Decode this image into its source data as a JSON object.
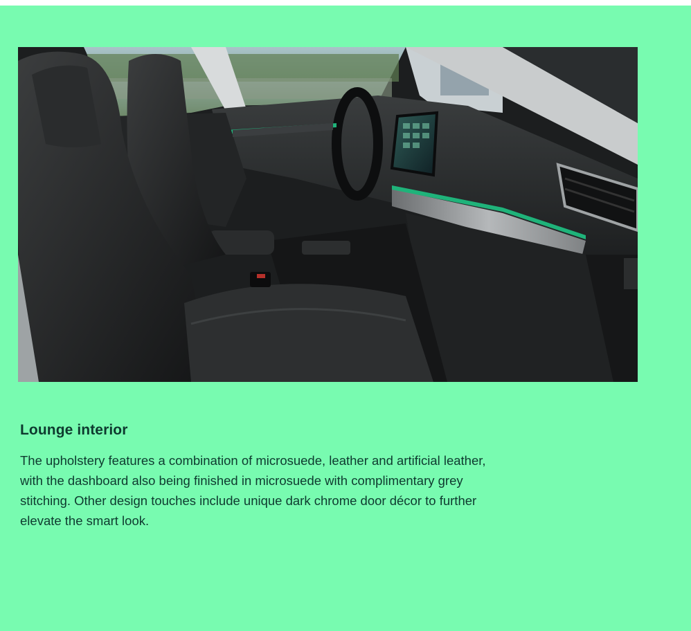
{
  "section": {
    "title": "Lounge interior",
    "body": "The upholstery features a combination of microsuede, leather and artificial leather, with the dashboard also being finished in microsuede with complimentary grey stitching. Other design touches include unique dark chrome door décor to further elevate the smart look."
  },
  "image": {
    "alt": "Car interior with black microsuede seats, dashboard with touchscreen and green ambient lighting"
  },
  "colors": {
    "background": "#78fbb0",
    "text": "#0e3a2f",
    "ambient_light": "#1fb37a"
  }
}
